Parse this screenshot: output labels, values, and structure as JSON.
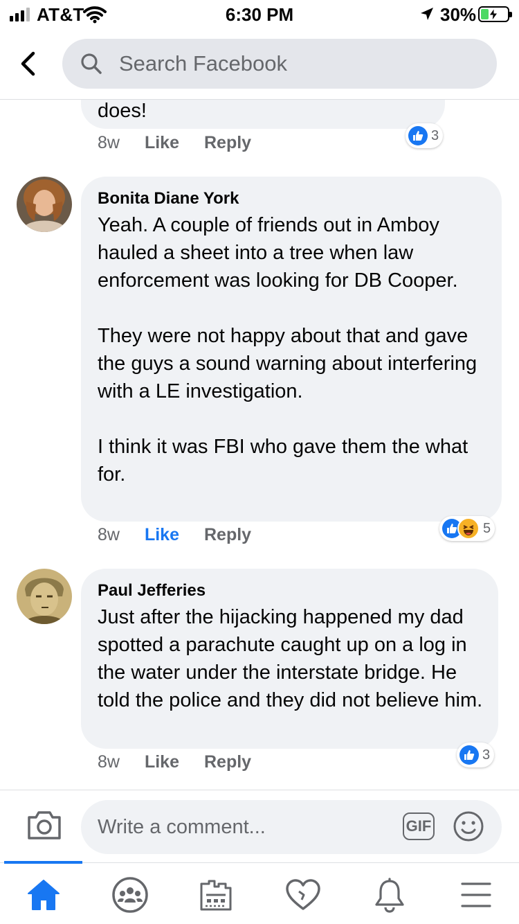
{
  "status_bar": {
    "carrier": "AT&T",
    "time": "6:30 PM",
    "battery": "30%",
    "battery_level": 0.3
  },
  "header": {
    "back_icon": "chevron-left-icon",
    "search_placeholder": "Search Facebook"
  },
  "comments": [
    {
      "author": "",
      "text": "does!",
      "time": "8w",
      "like_label": "Like",
      "reply_label": "Reply",
      "liked": false,
      "reactions": [
        "like"
      ],
      "reaction_count": "3"
    },
    {
      "author": "Bonita Diane York",
      "text": "Yeah. A couple of friends out in Amboy hauled a sheet into a tree when law enforcement was looking for DB Cooper.\n\nThey were not happy about that and gave the guys a sound warning about interfering with a LE investigation.\n\nI think it was FBI who gave them the what for.",
      "time": "8w",
      "like_label": "Like",
      "reply_label": "Reply",
      "liked": true,
      "reactions": [
        "like",
        "haha"
      ],
      "reaction_count": "5"
    },
    {
      "author": "Paul Jefferies",
      "text": "Just after the hijacking happened my dad spotted a parachute caught up on a log in the water under the interstate bridge. He told the police and they did not believe him.",
      "time": "8w",
      "like_label": "Like",
      "reply_label": "Reply",
      "liked": false,
      "reactions": [
        "like"
      ],
      "reaction_count": "3"
    }
  ],
  "composer": {
    "placeholder": "Write a comment...",
    "gif_label": "GIF"
  },
  "tabbar": {
    "tabs": [
      "home-icon",
      "groups-icon",
      "marketplace-icon",
      "dating-icon",
      "notifications-icon",
      "menu-icon"
    ],
    "active_tab": "home-icon"
  },
  "colors": {
    "accent": "#1877f2",
    "bubble": "#f0f2f5",
    "muted_text": "#65676b"
  }
}
